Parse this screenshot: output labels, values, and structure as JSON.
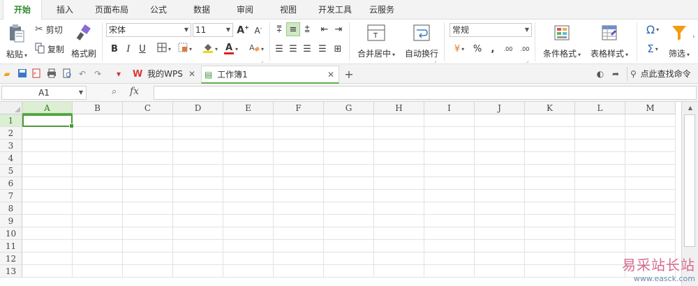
{
  "menu_tabs": [
    "开始",
    "插入",
    "页面布局",
    "公式",
    "数据",
    "审阅",
    "视图",
    "开发工具",
    "云服务"
  ],
  "active_menu_tab": 0,
  "ribbon": {
    "clipboard": {
      "paste": "粘贴",
      "cut": "剪切",
      "copy": "复制",
      "format_painter": "格式刷"
    },
    "font": {
      "name": "宋体",
      "size": "11",
      "bold": "B",
      "italic": "I",
      "underline": "U",
      "font_color_letter": "A"
    },
    "alignment": {
      "merge_center": "合并居中",
      "wrap_text": "自动换行"
    },
    "number": {
      "format": "常规",
      "percent": "%",
      "comma": ",",
      "inc_decimal": ".00",
      "dec_decimal": ".00"
    },
    "styles": {
      "conditional_format": "条件格式",
      "table_style": "表格样式"
    },
    "editing": {
      "symbol": "Ω",
      "sum": "Σ",
      "filter": "筛选"
    }
  },
  "doc_tabs": [
    {
      "label": "我的WPS",
      "active": false
    },
    {
      "label": "工作簿1",
      "active": true
    }
  ],
  "search_command": "点此查找命令",
  "formula_bar": {
    "cell_ref": "A1",
    "fx": "fx",
    "value": ""
  },
  "grid": {
    "columns": [
      "A",
      "B",
      "C",
      "D",
      "E",
      "F",
      "G",
      "H",
      "I",
      "J",
      "K",
      "L",
      "M"
    ],
    "rows": [
      "1",
      "2",
      "3",
      "4",
      "5",
      "6",
      "7",
      "8",
      "9",
      "10",
      "11",
      "12",
      "13"
    ],
    "active_cell": "A1"
  },
  "watermark": {
    "line1": "易采站长站",
    "line2": "www.easck.com"
  },
  "colors": {
    "accent": "#4a9a3a",
    "menu_active_text": "#2e8b2e",
    "header_bg": "#f5f5f5"
  }
}
